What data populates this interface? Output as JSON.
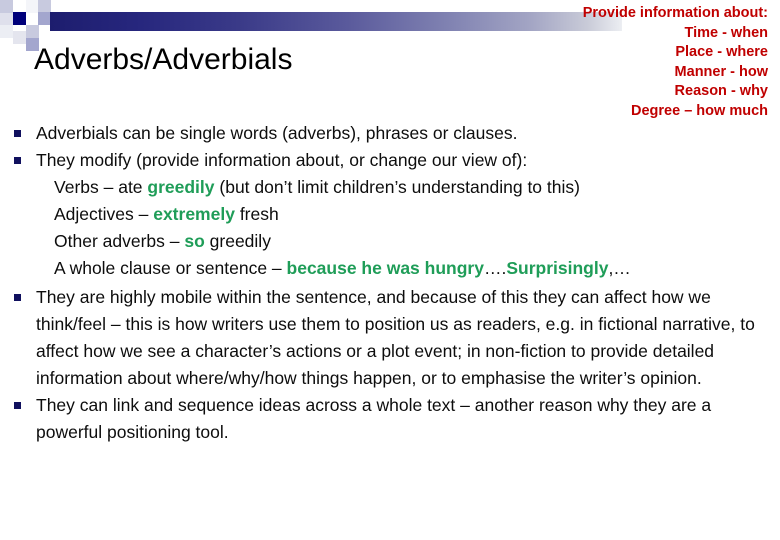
{
  "slide": {
    "title": "Adverbs/Adverbials",
    "colors": {
      "title_text": "#000000",
      "bullet_marker": "#10105E",
      "highlight_green": "#1F9D58",
      "info_red": "#C00000",
      "gradient_start": "#1D1D6E",
      "gradient_end": "#ECEEF2",
      "deco_navy": "#00007A",
      "deco_periwinkle": "#A3A6CE",
      "deco_light": "#C8CADF",
      "background": "#FFFFFF"
    }
  },
  "info_block": {
    "heading": "Provide information about:",
    "lines": [
      "Time - when",
      "Place - where",
      "Manner - how",
      "Reason - why",
      "Degree – how much"
    ]
  },
  "body": {
    "bullet1": "Adverbials can be single words (adverbs), phrases or clauses.",
    "bullet2": "They modify (provide information about, or change our view of):",
    "sub1": {
      "lead": "Verbs – ate ",
      "highlight": "greedily",
      "tail": " (but don’t limit children’s understanding to this)"
    },
    "sub2": {
      "lead": "Adjectives – ",
      "highlight": "extremely",
      "tail": " fresh"
    },
    "sub3": {
      "lead": "Other adverbs – ",
      "highlight": "so",
      "tail": " greedily"
    },
    "sub4": {
      "lead": "A whole clause or sentence – ",
      "highlight": "because he was hungry",
      "mid": "….",
      "highlight2": "Surprisingly",
      "tail": ",…"
    },
    "bullet3": "They are highly mobile within the sentence, and because of this they can affect how we think/feel – this is how writers use them to position us as readers, e.g. in fictional narrative, to affect how we see a character’s actions or a plot event; in non-fiction to provide detailed information about where/why/how things happen, or to emphasise the writer’s opinion.",
    "bullet4": "They can link and sequence ideas across a whole text – another reason why they are a powerful positioning tool."
  }
}
